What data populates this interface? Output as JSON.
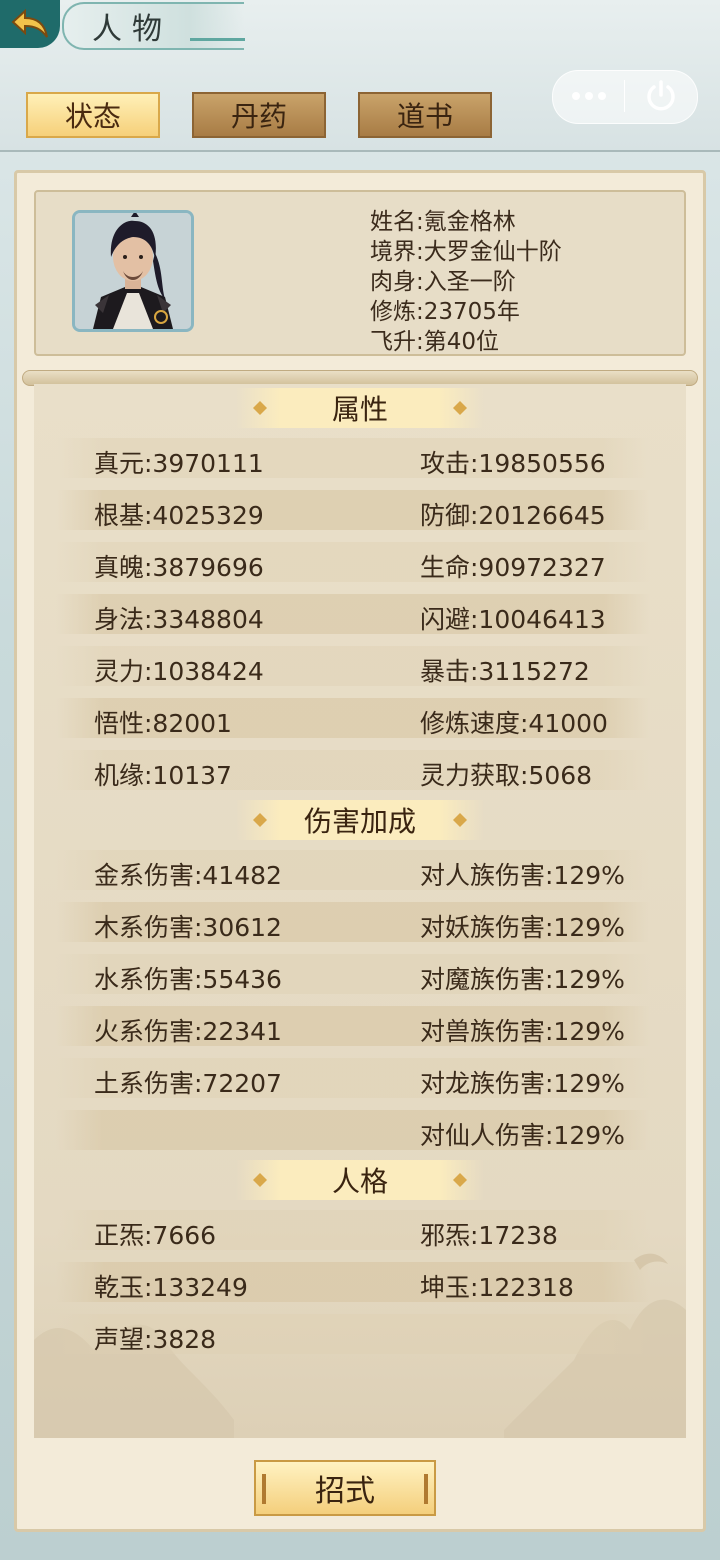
{
  "header": {
    "title": "人物",
    "tabs": [
      {
        "label": "状态",
        "active": true
      },
      {
        "label": "丹药",
        "active": false
      },
      {
        "label": "道书",
        "active": false
      }
    ]
  },
  "profile": {
    "name": "姓名:氪金格林",
    "realm": "境界:大罗金仙十阶",
    "body": "肉身:入圣一阶",
    "cultivation": "修炼:23705年",
    "ascension": "飞升:第40位"
  },
  "sections": {
    "attributes": {
      "title": "属性",
      "rows": [
        [
          "真元:3970111",
          "攻击:19850556"
        ],
        [
          "根基:4025329",
          "防御:20126645"
        ],
        [
          "真魄:3879696",
          "生命:90972327"
        ],
        [
          "身法:3348804",
          "闪避:10046413"
        ],
        [
          "灵力:1038424",
          "暴击:3115272"
        ],
        [
          "悟性:82001",
          "修炼速度:41000"
        ],
        [
          "机缘:10137",
          "灵力获取:5068"
        ]
      ]
    },
    "damage": {
      "title": "伤害加成",
      "rows": [
        [
          "金系伤害:41482",
          "对人族伤害:129%"
        ],
        [
          "木系伤害:30612",
          "对妖族伤害:129%"
        ],
        [
          "水系伤害:55436",
          "对魔族伤害:129%"
        ],
        [
          "火系伤害:22341",
          "对兽族伤害:129%"
        ],
        [
          "土系伤害:72207",
          "对龙族伤害:129%"
        ],
        [
          "",
          "对仙人伤害:129%"
        ]
      ]
    },
    "personality": {
      "title": "人格",
      "rows": [
        [
          "正炁:7666",
          "邪炁:17238"
        ],
        [
          "乾玉:133249",
          "坤玉:122318"
        ],
        [
          "声望:3828",
          ""
        ]
      ]
    }
  },
  "bottom_button": "招式",
  "icons": [
    "back-arrow-icon",
    "more-dots-icon",
    "power-icon"
  ],
  "colors": {
    "accent_teal": "#1f6b6a",
    "gold": "#f6d07a",
    "parchment": "#e9dfc9"
  }
}
